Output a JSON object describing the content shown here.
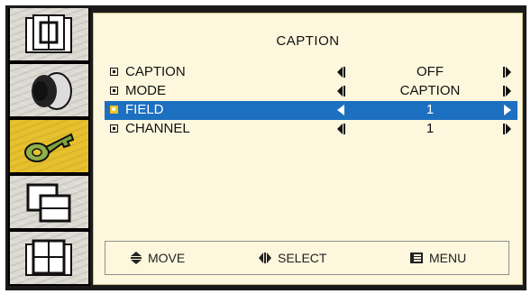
{
  "menu": {
    "title": "CAPTION",
    "items": [
      {
        "label": "CAPTION",
        "value": "OFF",
        "selected": false
      },
      {
        "label": "MODE",
        "value": "CAPTION",
        "selected": false
      },
      {
        "label": "FIELD",
        "value": "1",
        "selected": true
      },
      {
        "label": "CHANNEL",
        "value": "1",
        "selected": false
      }
    ]
  },
  "footer": {
    "move": "MOVE",
    "select": "SELECT",
    "menu": "MENU"
  },
  "sidebar": {
    "icons": [
      "picture-icon",
      "sound-icon",
      "key-icon",
      "window-icon",
      "setup-icon"
    ],
    "active_index": 2
  },
  "colors": {
    "panel_bg": "#fdf7dd",
    "selected_row": "#1d6fc0",
    "active_tab": "#e7c02d"
  }
}
